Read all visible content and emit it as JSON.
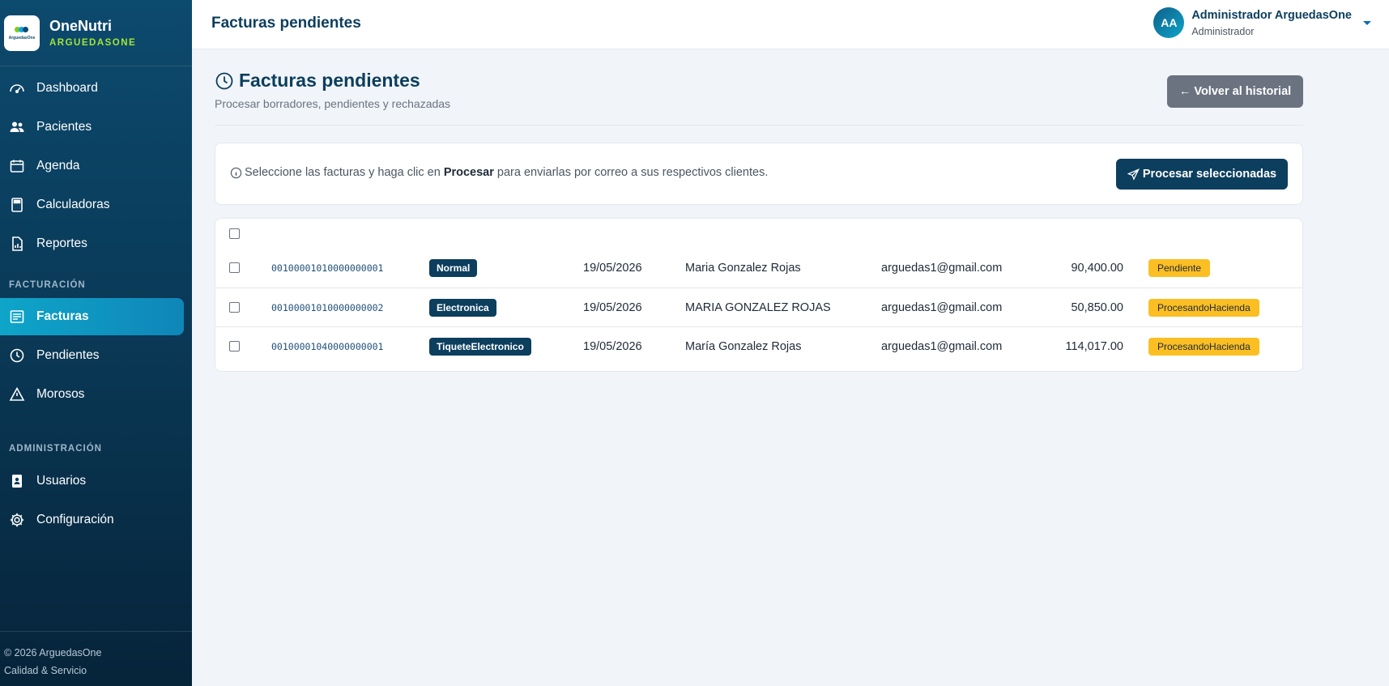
{
  "brand": {
    "title": "OneNutri",
    "subtitle": "ARGUEDASONE",
    "logo_text": "ArguedasOne"
  },
  "sidebar": {
    "items": [
      {
        "label": "Dashboard"
      },
      {
        "label": "Pacientes"
      },
      {
        "label": "Agenda"
      },
      {
        "label": "Calculadoras"
      },
      {
        "label": "Reportes"
      },
      {
        "label": "Facturas"
      },
      {
        "label": "Pendientes"
      },
      {
        "label": "Morosos"
      },
      {
        "label": "Usuarios"
      },
      {
        "label": "Configuración"
      }
    ],
    "sections": {
      "billing": "FACTURACIÓN",
      "admin": "ADMINISTRACIÓN"
    },
    "footer": {
      "copyright": "© 2026 ArguedasOne",
      "tagline": "Calidad & Servicio"
    }
  },
  "topbar": {
    "title": "Facturas pendientes",
    "user": {
      "initials": "AA",
      "name": "Administrador ArguedasOne",
      "role": "Administrador"
    }
  },
  "page": {
    "title": "Facturas pendientes",
    "subtitle": "Procesar borradores, pendientes y rechazadas",
    "back_button": "← Volver al historial",
    "info": {
      "before": "Seleccione las facturas y haga clic en",
      "bold": "Procesar",
      "after": "para enviarlas por correo a sus respectivos clientes."
    },
    "process_button": "Procesar seleccionadas"
  },
  "invoices": [
    {
      "number": "00100001010000000001",
      "type": "Normal",
      "date": "19/05/2026",
      "client": "Maria Gonzalez Rojas",
      "email": "arguedas1@gmail.com",
      "amount": "90,400.00",
      "status": "Pendiente"
    },
    {
      "number": "00100001010000000002",
      "type": "Electronica",
      "date": "19/05/2026",
      "client": "MARIA GONZALEZ ROJAS",
      "email": "arguedas1@gmail.com",
      "amount": "50,850.00",
      "status": "ProcesandoHacienda"
    },
    {
      "number": "00100001040000000001",
      "type": "TiqueteElectronico",
      "date": "19/05/2026",
      "client": "María Gonzalez Rojas",
      "email": "arguedas1@gmail.com",
      "amount": "114,017.00",
      "status": "ProcesandoHacienda"
    }
  ],
  "colors": {
    "sidebar": "#0c4a6e",
    "active": "#0ea5c9",
    "primary": "#0c3e5e",
    "status": "#fbbf24",
    "secondary_button": "#6b7280"
  }
}
